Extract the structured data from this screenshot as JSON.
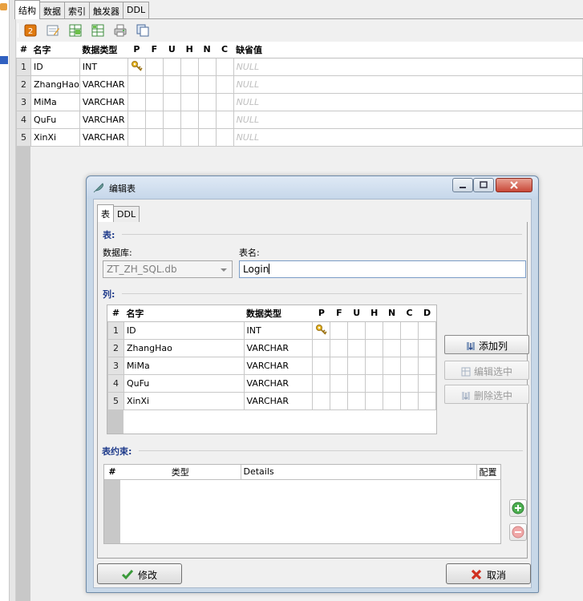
{
  "main_tabs": [
    {
      "label": "结构",
      "active": true
    },
    {
      "label": "数据",
      "active": false
    },
    {
      "label": "索引",
      "active": false
    },
    {
      "label": "触发器",
      "active": false
    },
    {
      "label": "DDL",
      "active": false
    }
  ],
  "toolbar_icons": [
    "add-icon",
    "edit-icon",
    "grid-add-icon",
    "grid-icon",
    "print-icon",
    "copy-icon"
  ],
  "columns_header": [
    "#",
    "名字",
    "数据类型",
    "P",
    "F",
    "U",
    "H",
    "N",
    "C",
    "缺省值"
  ],
  "columns_rows": [
    {
      "num": "1",
      "name": "ID",
      "type": "INT",
      "pk": true,
      "default": "NULL"
    },
    {
      "num": "2",
      "name": "ZhangHao",
      "type": "VARCHAR",
      "pk": false,
      "default": "NULL"
    },
    {
      "num": "3",
      "name": "MiMa",
      "type": "VARCHAR",
      "pk": false,
      "default": "NULL"
    },
    {
      "num": "4",
      "name": "QuFu",
      "type": "VARCHAR",
      "pk": false,
      "default": "NULL"
    },
    {
      "num": "5",
      "name": "XinXi",
      "type": "VARCHAR",
      "pk": false,
      "default": "NULL"
    }
  ],
  "dialog": {
    "title": "编辑表",
    "tabs": [
      {
        "label": "表",
        "active": true
      },
      {
        "label": "DDL",
        "active": false
      }
    ],
    "table_group": "表:",
    "database_label": "数据库:",
    "database_value": "ZT_ZH_SQL.db",
    "tablename_label": "表名:",
    "tablename_value": "Login",
    "columns_group": "列:",
    "col_header": [
      "#",
      "名字",
      "数据类型",
      "P",
      "F",
      "U",
      "H",
      "N",
      "C",
      "D"
    ],
    "col_rows": [
      {
        "num": "1",
        "name": "ID",
        "type": "INT",
        "pk": true
      },
      {
        "num": "2",
        "name": "ZhangHao",
        "type": "VARCHAR",
        "pk": false
      },
      {
        "num": "3",
        "name": "MiMa",
        "type": "VARCHAR",
        "pk": false
      },
      {
        "num": "4",
        "name": "QuFu",
        "type": "VARCHAR",
        "pk": false
      },
      {
        "num": "5",
        "name": "XinXi",
        "type": "VARCHAR",
        "pk": false
      }
    ],
    "add_column": "添加列",
    "edit_selected": "编辑选中",
    "delete_selected": "删除选中",
    "constraints_group": "表约束:",
    "con_header": [
      "#",
      "类型",
      "Details",
      "配置"
    ],
    "ok_label": "修改",
    "cancel_label": "取消"
  },
  "colors": {
    "accent_label": "#1e3a8a",
    "key_icon": "#d8a020",
    "null_text": "#c0c0c0"
  }
}
